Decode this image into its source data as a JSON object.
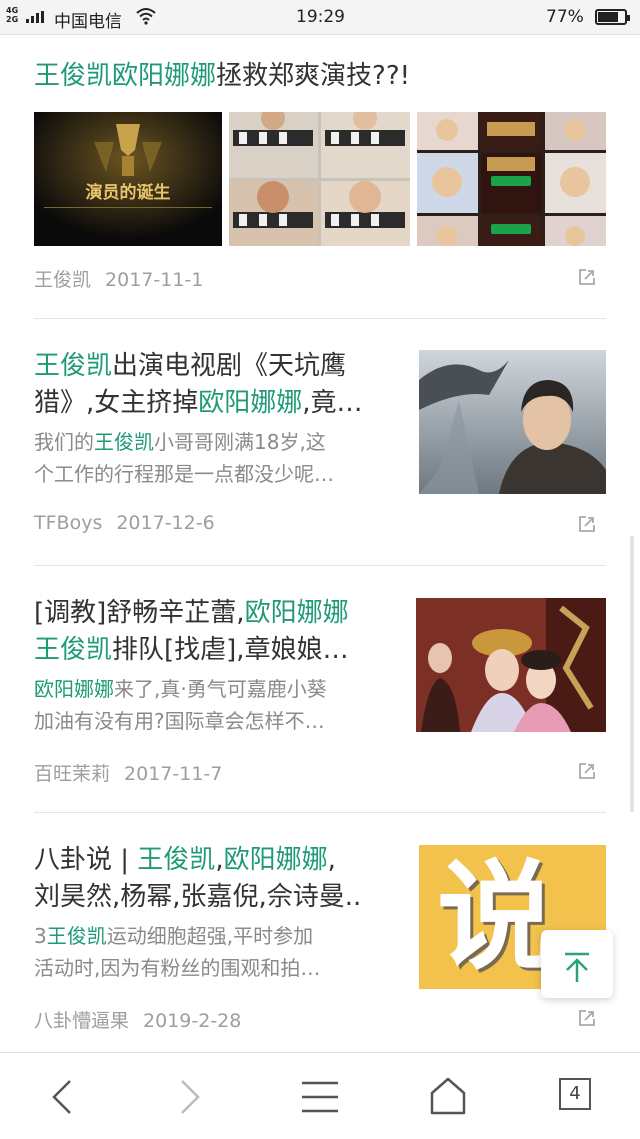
{
  "status_bar": {
    "network": "4G",
    "network2": "2G",
    "carrier": "中国电信",
    "time": "19:29",
    "battery": "77%",
    "battery_level": 0.77
  },
  "articles": [
    {
      "title_parts": [
        {
          "text": "王俊凯欧阳娜娜",
          "hl": true
        },
        {
          "text": "拯救郑爽演技??!",
          "hl": false
        }
      ],
      "source": "王俊凯",
      "date": "2017-11-1",
      "image_text": "演员的诞生"
    },
    {
      "title_parts": [
        {
          "text": "王俊凯",
          "hl": true
        },
        {
          "text": "出演电视剧《天坑鹰",
          "hl": false
        }
      ],
      "title_line2": [
        {
          "text": "猎》,女主挤掉",
          "hl": false
        },
        {
          "text": "欧阳娜娜",
          "hl": true
        },
        {
          "text": ",竟…",
          "hl": false
        }
      ],
      "summary_line1": [
        {
          "text": "我们的",
          "hl": false
        },
        {
          "text": "王俊凯",
          "hl": true
        },
        {
          "text": "小哥哥刚满18岁,这",
          "hl": false
        }
      ],
      "summary_line2": "个工作的行程那是一点都没少呢…",
      "source": "TFBoys",
      "date": "2017-12-6"
    },
    {
      "title_parts": [
        {
          "text": "[调教]舒畅辛芷蕾,",
          "hl": false
        },
        {
          "text": "欧阳娜娜",
          "hl": true
        }
      ],
      "title_line2": [
        {
          "text": "王俊凯",
          "hl": true
        },
        {
          "text": "排队[找虐],章娘娘…",
          "hl": false
        }
      ],
      "summary_line1": [
        {
          "text": "欧阳娜娜",
          "hl": true
        },
        {
          "text": "来了,真·勇气可嘉鹿小葵",
          "hl": false
        }
      ],
      "summary_line2": "加油有没有用?国际章会怎样不…",
      "source": "百旺茉莉",
      "date": "2017-11-7"
    },
    {
      "title_parts": [
        {
          "text": "八卦说 | ",
          "hl": false
        },
        {
          "text": "王俊凯",
          "hl": true
        },
        {
          "text": ",",
          "hl": false
        },
        {
          "text": "欧阳娜娜",
          "hl": true
        },
        {
          "text": ",",
          "hl": false
        }
      ],
      "title_line2_text": "刘昊然,杨幂,张嘉倪,佘诗曼..",
      "summary_line1": [
        {
          "text": "3",
          "hl": false
        },
        {
          "text": "王俊凯",
          "hl": true
        },
        {
          "text": "运动细胞超强,平时参加",
          "hl": false
        }
      ],
      "summary_line2": "活动时,因为有粉丝的围观和拍…",
      "source": "八卦懵逼果",
      "date": "2019-2-28",
      "image_text": "说"
    }
  ],
  "bottom_nav": {
    "tab_count": "4"
  },
  "colors": {
    "highlight": "#1e9a77",
    "text": "#333333",
    "muted": "#8a8a8a"
  }
}
